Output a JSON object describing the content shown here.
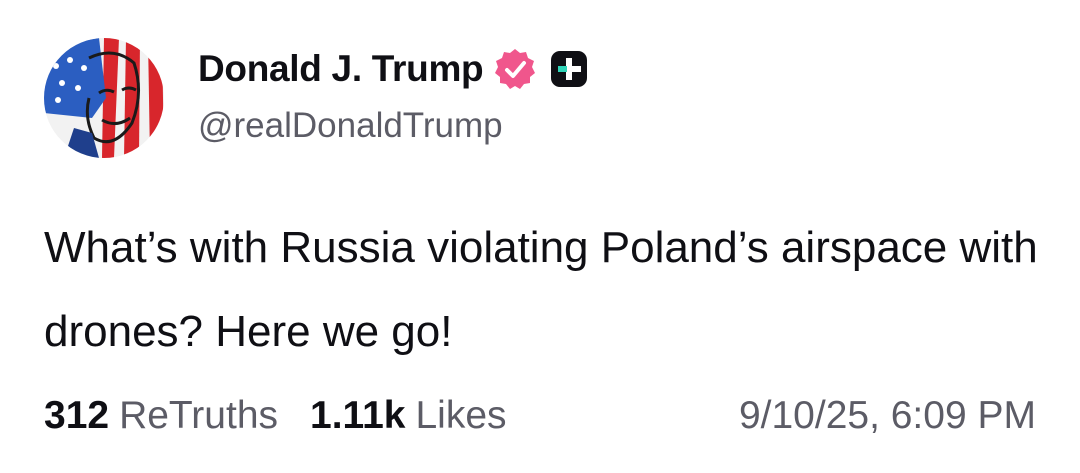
{
  "author": {
    "display_name": "Donald J. Trump",
    "handle": "@realDonaldTrump",
    "verified_icon": "verified-badge-icon",
    "verified_color": "#f0568c",
    "plus_icon": "truth-plus-icon"
  },
  "post": {
    "text": "What’s with Russia violating Poland’s airspace with drones? Here we go!"
  },
  "stats": {
    "retruths_count": "312",
    "retruths_label": "ReTruths",
    "likes_count": "1.11k",
    "likes_label": "Likes",
    "timestamp": "9/10/25, 6:09 PM"
  }
}
